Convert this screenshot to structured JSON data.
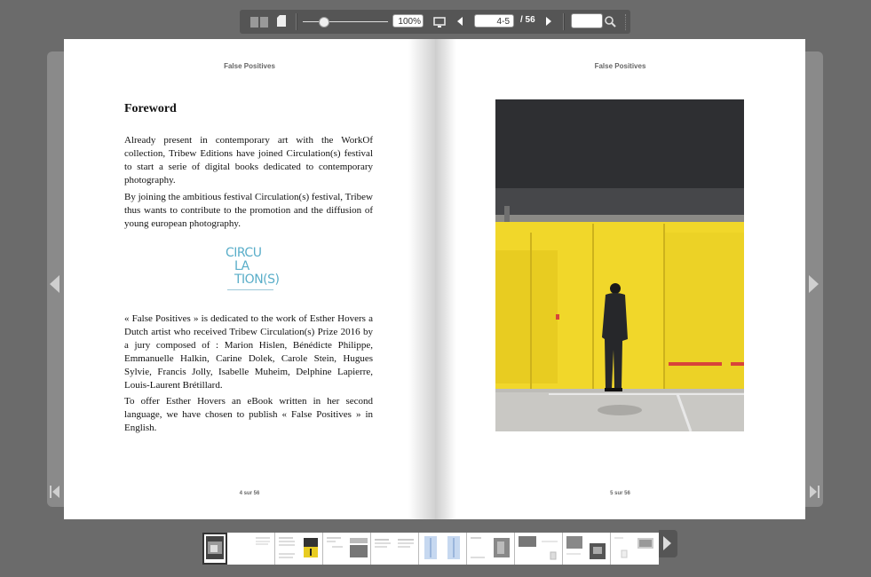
{
  "toolbar": {
    "zoom_value": "100%",
    "page_value": "4-5",
    "page_total": "/ 56",
    "search_value": ""
  },
  "book": {
    "running_head_left": "False Positives",
    "running_head_right": "False Positives",
    "folio_left": "4 sur 56",
    "folio_right": "5 sur 56",
    "heading": "Foreword",
    "paragraphs": [
      "Already present in contemporary art with the WorkOf collection, Tribew Editions have joined Circulation(s) festival to start a serie of digital books dedicated to contemporary photography.",
      "By joining the ambitious festival Circulation(s) festival, Tribew thus wants to contribute to the promotion and the diffusion of young european photography.",
      "« False Positives » is dedicated to the work of Esther Hovers a Dutch artist who received Tribew Circulation(s) Prize 2016 by a jury composed of : Marion Hislen, Bénédicte Philippe, Emmanuelle Halkin, Carine Dolek, Carole Stein, Hugues Sylvie, Francis Jolly, Isabelle Muheim, Delphine Lapierre, Louis-Laurent Brétillard.",
      "To offer Esther Hovers an eBook written in her second language, we have chosen to publish « False Positives » in English."
    ],
    "logo_lines": [
      "CIRCU",
      "LA",
      "TION(S)"
    ]
  },
  "colors": {
    "background": "#6b6b6b",
    "toolbar": "#555555",
    "logo": "#5aaec9",
    "photo_yellow": "#f1d72a"
  },
  "icons": {
    "double_page": "double-page-icon",
    "single_page": "single-page-icon",
    "fullscreen": "monitor-icon",
    "prev": "triangle-left-icon",
    "next": "triangle-right-icon",
    "search": "magnifier-icon"
  }
}
